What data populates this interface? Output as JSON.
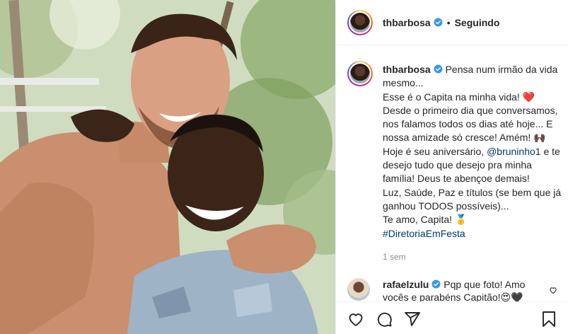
{
  "header": {
    "username": "thbarbosa",
    "separator": "•",
    "follow_status": "Seguindo"
  },
  "caption": {
    "username": "thbarbosa",
    "line1": "Pensa num irmão da vida mesmo...",
    "line2": "Esse é o Capita na minha vida! ❤️",
    "line3": "Desde o primeiro dia que conversamos, nos falamos todos os dias até hoje... E nossa amizade só cresce! Amém! 🙌🏿",
    "line4_prefix": "Hoje é seu aniversário,",
    "mention": "@bruninho1",
    "line4_suffix": "e te desejo tudo que desejo pra minha família! Deus te abençoe demais!",
    "line5": "Luz, Saúde, Paz e títulos (se bem que já ganhou TODOS possíveis)...",
    "line6": "Te amo, Capita! 🥇",
    "hashtag": "#DiretoriaEmFesta",
    "time_ago": "1 sem"
  },
  "comment": {
    "username": "rafaelzulu",
    "text": "Pqp que foto! Amo vocês e parabéns Capitão!😍🖤"
  },
  "icons": {
    "verified": "verified-badge-icon",
    "like": "heart-icon",
    "comment": "comment-icon",
    "share": "share-icon",
    "save": "bookmark-icon"
  },
  "colors": {
    "verified": "#3897f0",
    "link": "#00376b",
    "muted": "#8e8e8e",
    "border": "#efefef"
  }
}
